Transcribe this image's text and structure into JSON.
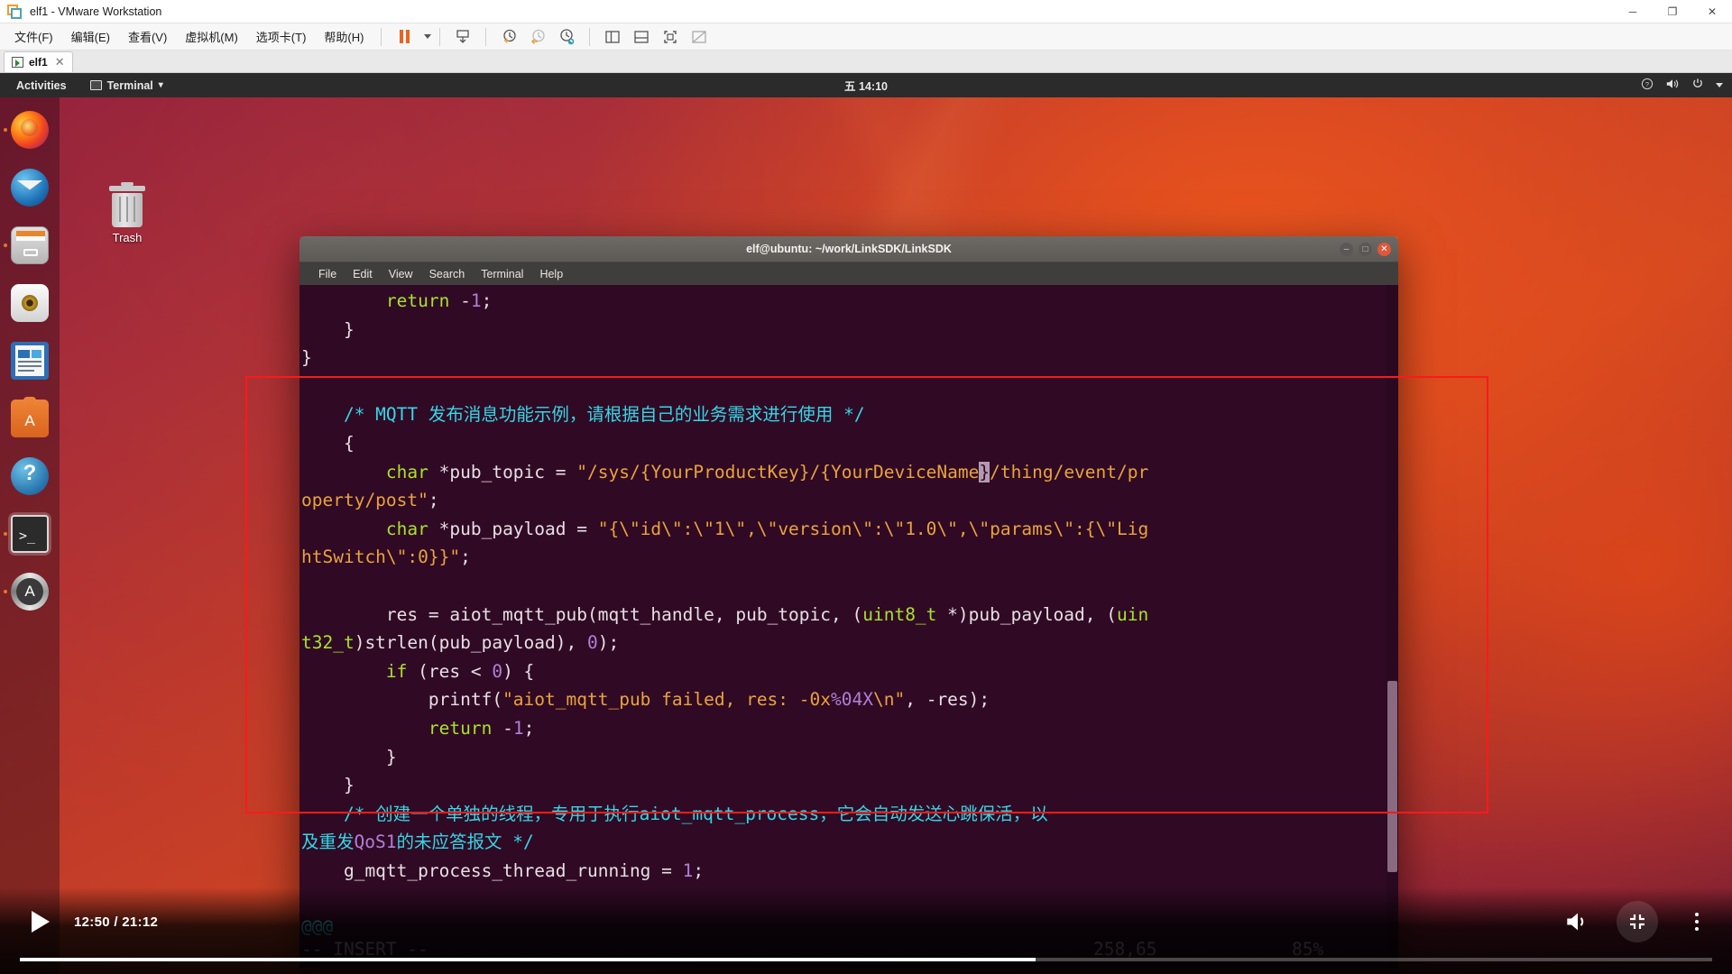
{
  "vmware": {
    "title": "elf1 - VMware Workstation",
    "window_buttons": {
      "minimize": "─",
      "maximize": "❐",
      "close": "✕"
    },
    "menus": [
      "文件(F)",
      "编辑(E)",
      "查看(V)",
      "虚拟机(M)",
      "选项卡(T)",
      "帮助(H)"
    ],
    "toolbar_icons": [
      "pause-icon",
      "dropdown-caret-icon",
      "send-ctrl-alt-del-icon",
      "snapshot-take-icon",
      "snapshot-revert-icon",
      "snapshot-manager-icon",
      "show-two-pane-icon",
      "show-console-icon",
      "fullscreen-icon",
      "unity-mode-icon"
    ],
    "tab": {
      "label": "elf1",
      "close": "✕"
    }
  },
  "gnome": {
    "activities": "Activities",
    "app_menu": "Terminal",
    "app_menu_caret": "▾",
    "clock": "五 14:10",
    "right_icons": [
      "help-icon",
      "volume-icon",
      "power-icon",
      "system-menu-caret-icon"
    ]
  },
  "dock": {
    "items": [
      {
        "name": "firefox",
        "label": "Firefox",
        "active": false
      },
      {
        "name": "thunderbird",
        "label": "Thunderbird Mail",
        "active": false
      },
      {
        "name": "files",
        "label": "Files",
        "active": false
      },
      {
        "name": "rhythmbox",
        "label": "Rhythmbox",
        "active": false
      },
      {
        "name": "libreoffice-writer",
        "label": "LibreOffice Writer",
        "active": false
      },
      {
        "name": "ubuntu-software",
        "label": "Ubuntu Software",
        "active": false
      },
      {
        "name": "help",
        "label": "Help",
        "active": false
      },
      {
        "name": "terminal",
        "label": "Terminal",
        "active": true
      },
      {
        "name": "show-applications",
        "label": "Show Applications",
        "active": false
      }
    ]
  },
  "desktop": {
    "trash_label": "Trash"
  },
  "terminal": {
    "title": "elf@ubuntu: ~/work/LinkSDK/LinkSDK",
    "menus": [
      "File",
      "Edit",
      "View",
      "Search",
      "Terminal",
      "Help"
    ],
    "window_buttons": {
      "minimize": "–",
      "maximize": "□",
      "close": "✕"
    },
    "status": {
      "mode": "-- INSERT --",
      "position": "258,65",
      "percent": "85%",
      "fold_marker": "@@@"
    }
  },
  "code": {
    "lines": [
      {
        "indent": 0,
        "tokens": [
          {
            "t": "        ",
            "c": "plain"
          },
          {
            "t": "return",
            "c": "kw"
          },
          {
            "t": " -",
            "c": "plain"
          },
          {
            "t": "1",
            "c": "num"
          },
          {
            "t": ";",
            "c": "plain"
          }
        ]
      },
      {
        "indent": 0,
        "tokens": [
          {
            "t": "    }",
            "c": "plain"
          }
        ]
      },
      {
        "indent": 0,
        "tokens": [
          {
            "t": "}",
            "c": "plain"
          }
        ]
      },
      {
        "indent": 0,
        "tokens": [
          {
            "t": "",
            "c": "plain"
          }
        ]
      },
      {
        "indent": 0,
        "tokens": [
          {
            "t": "    /* MQTT 发布消息功能示例，请根据自己的业务需求进行使用 */",
            "c": "comment"
          }
        ]
      },
      {
        "indent": 0,
        "tokens": [
          {
            "t": "    {",
            "c": "plain"
          }
        ]
      },
      {
        "indent": 0,
        "tokens": [
          {
            "t": "        ",
            "c": "plain"
          },
          {
            "t": "char",
            "c": "kw"
          },
          {
            "t": " *pub_topic = ",
            "c": "plain"
          },
          {
            "t": "\"/sys/{YourProductKey}/{YourDeviceName",
            "c": "str"
          },
          {
            "t": "}",
            "c": "cursor"
          },
          {
            "t": "/thing/event/pr",
            "c": "str"
          }
        ]
      },
      {
        "indent": 0,
        "tokens": [
          {
            "t": "operty/post\"",
            "c": "str"
          },
          {
            "t": ";",
            "c": "plain"
          }
        ]
      },
      {
        "indent": 0,
        "tokens": [
          {
            "t": "        ",
            "c": "plain"
          },
          {
            "t": "char",
            "c": "kw"
          },
          {
            "t": " *pub_payload = ",
            "c": "plain"
          },
          {
            "t": "\"{\\\"id\\\":\\\"1\\\",\\\"version\\\":\\\"1.0\\\",\\\"params\\\":{\\\"Lig",
            "c": "str"
          }
        ]
      },
      {
        "indent": 0,
        "tokens": [
          {
            "t": "htSwitch\\\":0}}\"",
            "c": "str"
          },
          {
            "t": ";",
            "c": "plain"
          }
        ]
      },
      {
        "indent": 0,
        "tokens": [
          {
            "t": "",
            "c": "plain"
          }
        ]
      },
      {
        "indent": 0,
        "tokens": [
          {
            "t": "        res = aiot_mqtt_pub(mqtt_handle, pub_topic, (",
            "c": "plain"
          },
          {
            "t": "uint8_t",
            "c": "kw"
          },
          {
            "t": " *)pub_payload, (",
            "c": "plain"
          },
          {
            "t": "uin",
            "c": "kw"
          }
        ]
      },
      {
        "indent": 0,
        "tokens": [
          {
            "t": "t32_t",
            "c": "kw"
          },
          {
            "t": ")strlen(pub_payload), ",
            "c": "plain"
          },
          {
            "t": "0",
            "c": "num"
          },
          {
            "t": ");",
            "c": "plain"
          }
        ]
      },
      {
        "indent": 0,
        "tokens": [
          {
            "t": "        ",
            "c": "plain"
          },
          {
            "t": "if",
            "c": "kw"
          },
          {
            "t": " (res < ",
            "c": "plain"
          },
          {
            "t": "0",
            "c": "num"
          },
          {
            "t": ") {",
            "c": "plain"
          }
        ]
      },
      {
        "indent": 0,
        "tokens": [
          {
            "t": "            printf(",
            "c": "plain"
          },
          {
            "t": "\"aiot_mqtt_pub failed, res: -0x",
            "c": "str"
          },
          {
            "t": "%04X",
            "c": "num"
          },
          {
            "t": "\\n\"",
            "c": "str"
          },
          {
            "t": ", -res);",
            "c": "plain"
          }
        ]
      },
      {
        "indent": 0,
        "tokens": [
          {
            "t": "            ",
            "c": "plain"
          },
          {
            "t": "return",
            "c": "kw"
          },
          {
            "t": " -",
            "c": "plain"
          },
          {
            "t": "1",
            "c": "num"
          },
          {
            "t": ";",
            "c": "plain"
          }
        ]
      },
      {
        "indent": 0,
        "tokens": [
          {
            "t": "        }",
            "c": "plain"
          }
        ]
      },
      {
        "indent": 0,
        "tokens": [
          {
            "t": "    }",
            "c": "plain"
          }
        ]
      },
      {
        "indent": 0,
        "tokens": [
          {
            "t": "    /* 创建一个单独的线程，专用于执行aiot_mqtt_process，它会自动发送心跳保活，以",
            "c": "comment"
          }
        ]
      },
      {
        "indent": 0,
        "tokens": [
          {
            "t": "及重发",
            "c": "comment"
          },
          {
            "t": "QoS1",
            "c": "num"
          },
          {
            "t": "的未应答报文 */",
            "c": "comment"
          }
        ]
      },
      {
        "indent": 0,
        "tokens": [
          {
            "t": "    g_mqtt_process_thread_running = ",
            "c": "plain"
          },
          {
            "t": "1",
            "c": "num"
          },
          {
            "t": ";",
            "c": "plain"
          }
        ]
      }
    ]
  },
  "annotation": {
    "highlight_color": "#f71b1b",
    "shape": "rectangle"
  },
  "player": {
    "play_label": "play-icon",
    "time": "12:50 / 21:12",
    "current": "12:50",
    "duration": "21:12",
    "progress_percent": 60,
    "controls": [
      "volume-icon",
      "exit-fullscreen-icon",
      "more-options-icon"
    ]
  }
}
